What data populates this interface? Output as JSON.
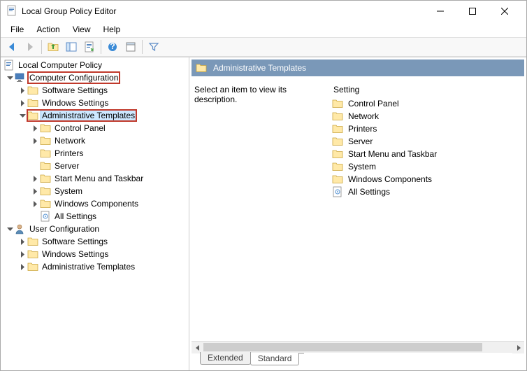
{
  "window": {
    "title": "Local Group Policy Editor"
  },
  "menu": {
    "file": "File",
    "action": "Action",
    "view": "View",
    "help": "Help"
  },
  "tree": {
    "root": "Local Computer Policy",
    "cc": "Computer Configuration",
    "cc_children": {
      "sw": "Software Settings",
      "win": "Windows Settings",
      "at": "Administrative Templates",
      "at_children": {
        "cp": "Control Panel",
        "net": "Network",
        "prn": "Printers",
        "srv": "Server",
        "smt": "Start Menu and Taskbar",
        "sys": "System",
        "wc": "Windows Components",
        "all": "All Settings"
      }
    },
    "uc": "User Configuration",
    "uc_children": {
      "sw": "Software Settings",
      "win": "Windows Settings",
      "at": "Administrative Templates"
    }
  },
  "right": {
    "header": "Administrative Templates",
    "description": "Select an item to view its description.",
    "setting_header": "Setting",
    "items": {
      "cp": "Control Panel",
      "net": "Network",
      "prn": "Printers",
      "srv": "Server",
      "smt": "Start Menu and Taskbar",
      "sys": "System",
      "wc": "Windows Components",
      "all": "All Settings"
    }
  },
  "tabs": {
    "extended": "Extended",
    "standard": "Standard"
  }
}
